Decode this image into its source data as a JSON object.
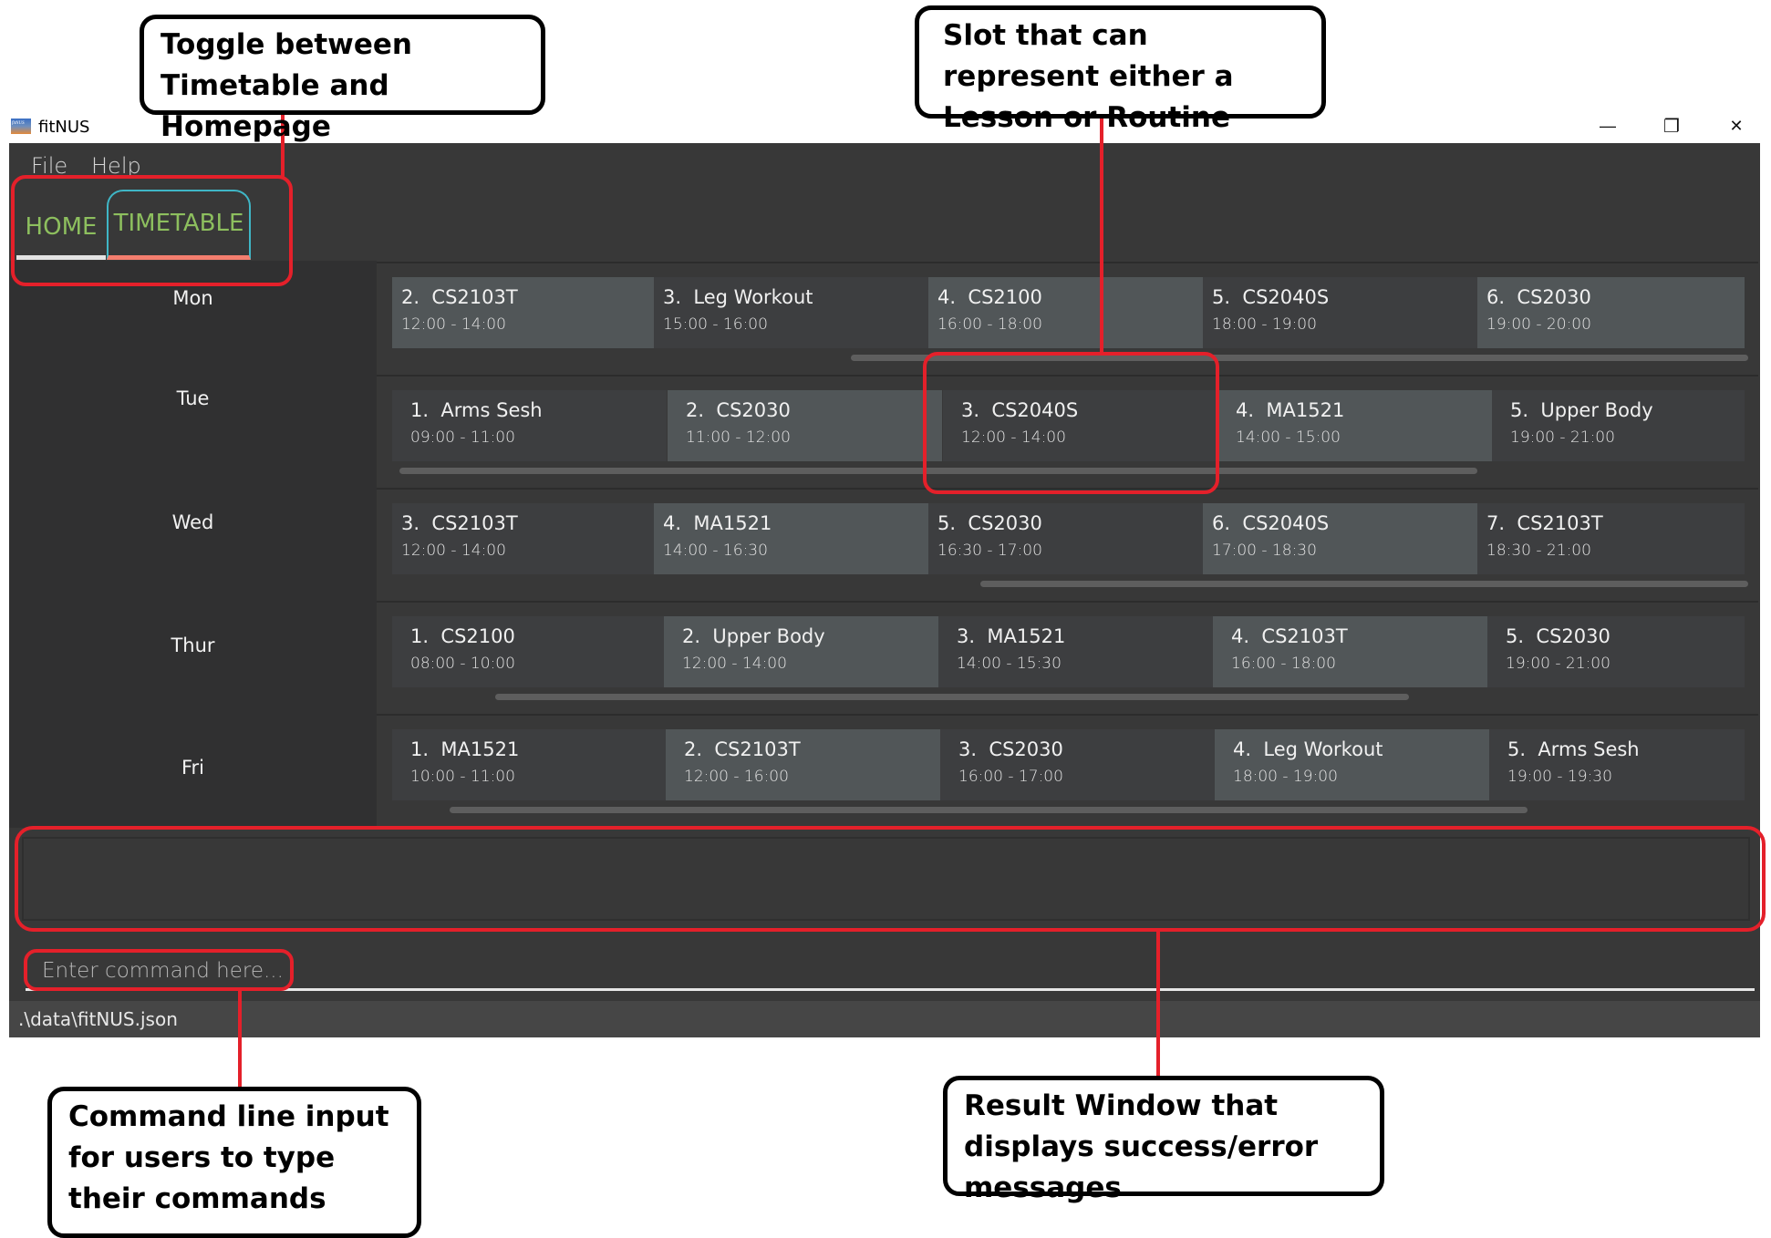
{
  "window": {
    "title": "fitNUS",
    "icon": "fitnus-logo-icon",
    "controls": {
      "minimize": "—",
      "restore": "❐",
      "close": "✕"
    }
  },
  "menu": {
    "items": [
      "File",
      "Help"
    ]
  },
  "tabs": [
    {
      "label": "HOME",
      "active": false
    },
    {
      "label": "TIMETABLE",
      "active": true
    }
  ],
  "timetable": {
    "days": [
      {
        "day": "Mon",
        "slots": [
          {
            "index": "2.",
            "name": "CS2103T",
            "time": "12:00 - 14:00"
          },
          {
            "index": "3.",
            "name": "Leg Workout",
            "time": "15:00 - 16:00"
          },
          {
            "index": "4.",
            "name": "CS2100",
            "time": "16:00 - 18:00"
          },
          {
            "index": "5.",
            "name": "CS2040S",
            "time": "18:00 - 19:00"
          },
          {
            "index": "6.",
            "name": "CS2030",
            "time": "19:00 - 20:00"
          }
        ]
      },
      {
        "day": "Tue",
        "slots": [
          {
            "index": "1.",
            "name": "Arms Sesh",
            "time": "09:00 - 11:00"
          },
          {
            "index": "2.",
            "name": "CS2030",
            "time": "11:00 - 12:00"
          },
          {
            "index": "3.",
            "name": "CS2040S",
            "time": "12:00 - 14:00"
          },
          {
            "index": "4.",
            "name": "MA1521",
            "time": "14:00 - 15:00"
          },
          {
            "index": "5.",
            "name": "Upper Body",
            "time": "19:00 - 21:00"
          }
        ]
      },
      {
        "day": "Wed",
        "slots": [
          {
            "index": "3.",
            "name": "CS2103T",
            "time": "12:00 - 14:00"
          },
          {
            "index": "4.",
            "name": "MA1521",
            "time": "14:00 - 16:30"
          },
          {
            "index": "5.",
            "name": "CS2030",
            "time": "16:30 - 17:00"
          },
          {
            "index": "6.",
            "name": "CS2040S",
            "time": "17:00 - 18:30"
          },
          {
            "index": "7.",
            "name": "CS2103T",
            "time": "18:30 - 21:00"
          }
        ]
      },
      {
        "day": "Thur",
        "slots": [
          {
            "index": "1.",
            "name": "CS2100",
            "time": "08:00 - 10:00"
          },
          {
            "index": "2.",
            "name": "Upper Body",
            "time": "12:00 - 14:00"
          },
          {
            "index": "3.",
            "name": "MA1521",
            "time": "14:00 - 15:30"
          },
          {
            "index": "4.",
            "name": "CS2103T",
            "time": "16:00 - 18:00"
          },
          {
            "index": "5.",
            "name": "CS2030",
            "time": "19:00 - 21:00"
          }
        ]
      },
      {
        "day": "Fri",
        "slots": [
          {
            "index": "1.",
            "name": "MA1521",
            "time": "10:00 - 11:00"
          },
          {
            "index": "2.",
            "name": "CS2103T",
            "time": "12:00 - 16:00"
          },
          {
            "index": "3.",
            "name": "CS2030",
            "time": "16:00 - 17:00"
          },
          {
            "index": "4.",
            "name": "Leg Workout",
            "time": "18:00 - 19:00"
          },
          {
            "index": "5.",
            "name": "Arms Sesh",
            "time": "19:00 - 19:30"
          }
        ]
      }
    ]
  },
  "result": {
    "text": ""
  },
  "command": {
    "value": "",
    "placeholder": "Enter command here..."
  },
  "status": {
    "file_path": ".\\data\\fitNUS.json"
  },
  "annotations": {
    "toggle": "Toggle between Timetable and Homepage",
    "slot": "Slot that can represent either a Lesson or Routine",
    "command": "Command line input for users to type their commands",
    "result": "Result Window that displays success/error messages"
  },
  "colors": {
    "tab_text": "#8dbf5e",
    "tab_active_border": "#3fb6c6",
    "tab_active_underline": "#f47e6e",
    "card_light": "#515658",
    "card_dark": "#3d3e40",
    "annotation_red": "#e4202a"
  }
}
